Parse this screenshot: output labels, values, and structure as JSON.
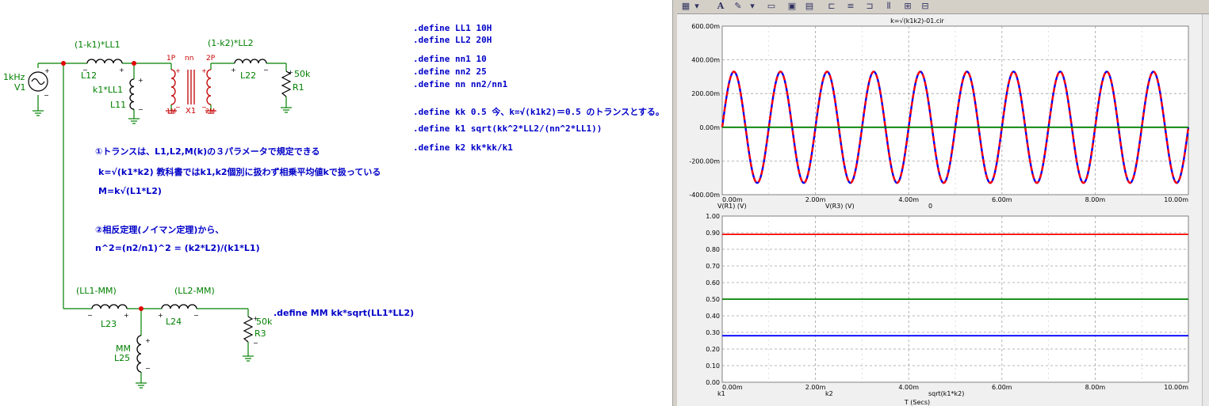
{
  "schematic": {
    "top_circuit": {
      "source_freq": "1kHz",
      "source_name": "V1",
      "l12_value": "(1-k1)*LL1",
      "l12_name": "L12",
      "l11_value": "k1*LL1",
      "l11_name": "L11",
      "tx_pin1": "1P",
      "tx_nn": "nn",
      "tx_pin2": "2P",
      "tx_name": "X1",
      "tx_pin1m": "1M",
      "tx_pin2m": "2M",
      "l22_value": "(1-k2)*LL2",
      "l22_name": "L22",
      "r1_value": "50k",
      "r1_name": "R1"
    },
    "bottom_circuit": {
      "l23_value": "(LL1-MM)",
      "l23_name": "L23",
      "l24_value": "(LL2-MM)",
      "l24_name": "L24",
      "l25_value": "MM",
      "l25_name": "L25",
      "r3_value": "50k",
      "r3_name": "R3",
      "mm_define": ".define MM kk*sqrt(LL1*LL2)"
    },
    "defines": [
      ".define LL1  10H",
      ".define LL2  20H",
      ".define nn1   10",
      ".define nn2   25",
      ".define nn  nn2/nn1",
      ".define kk  0.5  今、k=√(k1k2)＝0.5 のトランスとする。",
      ".define k1  sqrt(kk^2*LL2/(nn^2*LL1))",
      ".define k2  kk*kk/k1"
    ],
    "notes": [
      "①トランスは、L1,L2,M(k)の３パラメータで規定できる",
      "k=√(k1*k2)  教科書ではk1,k2個別に扱わず相乗平均値kで扱っている",
      "M=k√(L1*L2)",
      "②相反定理(ノイマン定理)から、",
      "n^2=(n2/n1)^2 = (k2*L2)/(k1*L1)"
    ]
  },
  "toolbar": {
    "icons": [
      "grid-icon",
      "dropdown-icon",
      "font-icon",
      "color-icon",
      "dropdown-icon",
      "copy-icon",
      "paste-icon",
      "paste2-icon",
      "align-left-icon",
      "align-center-icon",
      "align-right-icon",
      "split-icon",
      "stack-icon",
      "stack2-icon"
    ],
    "glyphs": [
      "▦",
      "▾",
      "A",
      "✎",
      "▾",
      "▭",
      "▣",
      "▤",
      "⊏",
      "≡",
      "⊐",
      "⫴",
      "⊞",
      "⊟"
    ]
  },
  "chart_data": [
    {
      "type": "line",
      "title": "k=√(k1k2)-01.cir",
      "x_tick_labels": [
        "0.00m",
        "2.00m",
        "4.00m",
        "6.00m",
        "8.00m",
        "10.00m"
      ],
      "y_tick_labels": [
        "600.00m",
        "400.00m",
        "200.00m",
        "0.00m",
        "-200.00m",
        "-400.00m"
      ],
      "xlim": [
        0,
        10
      ],
      "ylim": [
        -400,
        600
      ],
      "grid": true,
      "series": [
        {
          "name": "V(R1) (V)",
          "color": "#0000ff",
          "style": "solid",
          "kind": "sine",
          "amplitude": 330,
          "frequency_per_ms": 1.0,
          "phase_deg": 0
        },
        {
          "name": "V(R3) (V)",
          "color": "#ff0000",
          "style": "dashed",
          "kind": "sine",
          "amplitude": 330,
          "frequency_per_ms": 1.0,
          "phase_deg": 0
        },
        {
          "name": "0",
          "color": "#008000",
          "style": "solid",
          "kind": "const",
          "value": 0
        }
      ]
    },
    {
      "type": "line",
      "x_tick_labels": [
        "0.00m",
        "2.00m",
        "4.00m",
        "6.00m",
        "8.00m",
        "10.00m"
      ],
      "y_tick_labels": [
        "1.00",
        "0.90",
        "0.80",
        "0.70",
        "0.60",
        "0.50",
        "0.40",
        "0.30",
        "0.20",
        "0.10",
        "0.00"
      ],
      "xlim": [
        0,
        10
      ],
      "ylim": [
        0,
        1
      ],
      "xlabel": "T (Secs)",
      "grid": true,
      "series": [
        {
          "name": "k1",
          "color": "#0000ff",
          "style": "solid",
          "kind": "const",
          "value": 0.28
        },
        {
          "name": "k2",
          "color": "#ff0000",
          "style": "solid",
          "kind": "const",
          "value": 0.89
        },
        {
          "name": "sqrt(k1*k2)",
          "color": "#008000",
          "style": "solid",
          "kind": "const",
          "value": 0.5
        }
      ]
    }
  ]
}
